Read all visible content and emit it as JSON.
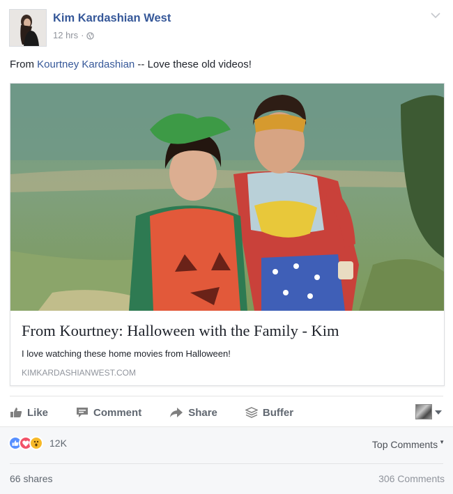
{
  "post": {
    "author": "Kim Kardashian West",
    "time": "12 hrs",
    "separator": "·",
    "icons": {
      "privacy": "globe-icon",
      "menu": "chevron-down-icon"
    },
    "status": {
      "prefix": "From ",
      "link": "Kourtney Kardashian",
      "suffix": " -- Love these old videos!"
    }
  },
  "link_card": {
    "image": "two children in halloween costumes (pumpkin and wonder woman) on a path",
    "title": "From Kourtney: Halloween with the Family - Kim",
    "description": "I love watching these home movies from Halloween!",
    "domain": "KIMKARDASHIANWEST.COM"
  },
  "actions": {
    "like": "Like",
    "comment": "Comment",
    "share": "Share",
    "buffer": "Buffer",
    "icons": [
      "thumbs-up-icon",
      "speech-bubble-icon",
      "share-arrow-icon",
      "buffer-stack-icon"
    ]
  },
  "footer": {
    "reactions": [
      "like-icon",
      "love-icon",
      "wow-icon"
    ],
    "reaction_count": "12K",
    "top_comments": "Top Comments",
    "shares": "66 shares",
    "comments": "306 Comments"
  },
  "colors": {
    "link": "#365899",
    "muted": "#90949c",
    "action": "#606770",
    "like": "#5890ff",
    "love": "#f25268",
    "wow": "#f7b928"
  }
}
